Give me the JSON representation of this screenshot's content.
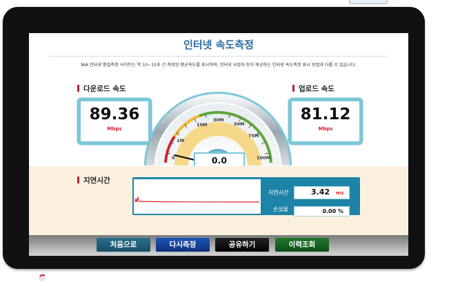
{
  "title": "인터넷 속도측정",
  "description": "NIA 인터넷 품질측정 사이트는 약 10~15초 간 측정된 평균속도를 표시하며, 인터넷 사업자 등이 제공하는 인터넷 속도측정 표시 방법과 다를 수 있습니다.",
  "download": {
    "label": "다운로드 속도",
    "value": "89.36",
    "unit": "Mbps"
  },
  "upload": {
    "label": "업로드 속도",
    "value": "81.12",
    "unit": "Mbps"
  },
  "gauge": {
    "ticks": [
      "0",
      "1M",
      "10M",
      "30M",
      "50M",
      "75M",
      "100M"
    ],
    "current_speed": "0.0",
    "needle_value": 0
  },
  "latency": {
    "label": "지연시간",
    "time_label": "지연시간",
    "time_value": "3.42",
    "time_unit": "ms",
    "loss_label": "손실율",
    "loss_value": "0.00 %"
  },
  "buttons": {
    "home": "처음으로",
    "retest": "다시측정",
    "share": "공유하기",
    "history": "이력조회"
  },
  "colors": {
    "accent_blue": "#2a6aa4",
    "frame_teal": "#7cc7d9",
    "unit_red": "#d2222a",
    "panel_teal": "#1d84a8"
  }
}
